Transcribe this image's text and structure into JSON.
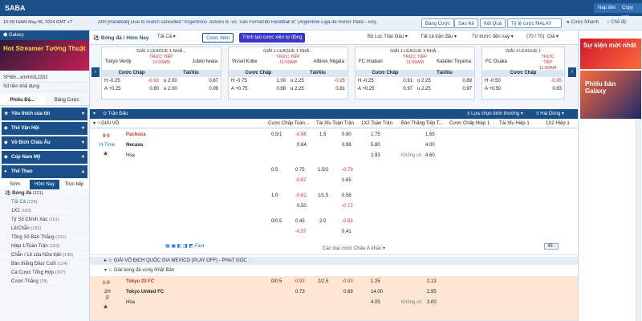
{
  "app": {
    "brand": "SABA",
    "login_label": "Nạp tiền",
    "account_label": "Copy Info"
  },
  "subbar": {
    "clock": "10:09:16AM May 06, 2024 GMT +7",
    "ticker": "Attn:[Handball] Due to match cancelled \"Argentinos Juniors B -vs- San Fernando Handball B\" [Argentine Liga de Honor Plata - 5/5],",
    "btn_bet": "Bảng Cược",
    "btn_stats": "Sao Kê",
    "btn_result": "Kết Quả",
    "odds_type": "Tỷ lệ cược MALAY",
    "radio_fast": "Cược Nhanh",
    "radio_dark": "Chế độ"
  },
  "sidebar": {
    "galaxy_label": "Galaxy",
    "banner_text": "Hot Streamer Tướng Thuật",
    "user": "SF68r...xmrhhl12332",
    "balance_label": "Số tiền khả dụng",
    "tab_live": "Phiếu Đặ...",
    "tab_bets": "Bảng Cược",
    "menu": [
      {
        "label": "Yêu thích của tôi"
      },
      {
        "label": "Thế Vận Hội"
      },
      {
        "label": "Vô Địch Châu Âu"
      },
      {
        "label": "Cúp Nam Mỹ"
      },
      {
        "label": "Thể Thao"
      }
    ],
    "sport_tabs": [
      "Sớm",
      "Hôm Nay",
      "Trực tiếp"
    ],
    "sport_head": "Bóng đá",
    "sport_head_count": "(321)",
    "sub_items": [
      {
        "label": "Tất Cả",
        "count": "(228)"
      },
      {
        "label": "1X2",
        "count": "(183)"
      },
      {
        "label": "Tỷ Số Chính Xác",
        "count": "(161)"
      },
      {
        "label": "Lẻ/Chẵn",
        "count": "(183)"
      },
      {
        "label": "Tổng Số Bàn Thắng",
        "count": "(161)"
      },
      {
        "label": "Hiệp 1/Toàn Trận",
        "count": "(183)"
      },
      {
        "label": "Chẵn / Lẻ của Nửa trận",
        "count": "(149)"
      },
      {
        "label": "Bàn thắng Đầu/ Cuối",
        "count": "(124)"
      },
      {
        "label": "Cá Cược Tổng Hợp",
        "count": "(307)"
      },
      {
        "label": "Cược Thắng",
        "count": "(28)"
      }
    ]
  },
  "filters": {
    "sport_title": "Bóng đá / Hôm Nay",
    "all": "Tất Cả",
    "combo": "Cược Xiên",
    "live_combo": "Trình tạo cược xiên tự động",
    "league_filter": "Bộ Lọc Trận Đấu",
    "all_leagues": "Tất cả trận đấu",
    "sort": "Từ trước đến nay",
    "count": "(70 / 70)",
    "one_x_two": "Giả"
  },
  "featured": [
    {
      "league": "GIẢI J-LEAGUE 1 NHẬ...",
      "home": "Tokyo Verdy",
      "away": "Jubilo Iwata",
      "status": "TRỰC TIẾP",
      "time": "11:00AM",
      "ah": [
        [
          "H -0.25",
          "-0.92"
        ],
        [
          "A +0.25",
          "0.80"
        ]
      ],
      "ou": [
        [
          "u 2.00",
          "0.87"
        ],
        [
          "u 2.00",
          "0.99"
        ]
      ]
    },
    {
      "league": "GIẢI J-LEAGUE 1 NHẬ...",
      "home": "Vissel Kobe",
      "away": "Albirex Niigata",
      "status": "TRỰC TIẾP",
      "time": "11:00AM",
      "ah": [
        [
          "H -0.75",
          "1.00"
        ],
        [
          "A +0.75",
          "0.88"
        ]
      ],
      "ou": [
        [
          "u 2.25",
          "-0.95"
        ],
        [
          "u 2.25",
          "0.81"
        ]
      ]
    },
    {
      "league": "GIẢI J-LEAGUE 3 NHẬ...",
      "home": "FC Imabari",
      "away": "Kataller Toyama",
      "status": "TRỰC TIẾP",
      "time": "11:00AM",
      "ah": [
        [
          "H -0.25",
          "0.91"
        ],
        [
          "A +0.25",
          "0.97"
        ]
      ],
      "ou": [
        [
          "u 2.25",
          "0.89"
        ],
        [
          "u 2.25",
          "0.97"
        ]
      ]
    },
    {
      "league": "GIẢI J-LEAGUE 1",
      "home": "FC Osaka",
      "away": "",
      "status": "TRỰC TIẾP",
      "time": "11:00AM",
      "ah": [
        [
          "H -0.50",
          "-0.95"
        ],
        [
          "A +0.50",
          "0.83"
        ]
      ],
      "ou": [
        [
          "",
          ""
        ],
        [
          "",
          ""
        ]
      ]
    }
  ],
  "section": {
    "title": "Trận Đấu",
    "pick_label": "Lựa chọn bình thường",
    "line_label": "Hai Dòng"
  },
  "columns": [
    "Cược Chấp Toàn ...",
    "Tài Xỉu Toàn Trận",
    "1X2 Toàn Trận",
    "Bàn Thắng Tiếp T...",
    "Cược Chấp Hiệp 1",
    "Tài Xỉu Hiệp 1",
    "1X2 Hiệp 1"
  ],
  "leagues": [
    {
      "name": "GIẢI VÔ ĐỊCH QUỐC GIA MEXICO (PLAY OFF)"
    },
    {
      "name": "GIẢI VÔ ĐỊCH QUỐC GIA MEXICO (PLAY OFF) - PHẠT GÓC"
    },
    {
      "name": "Giải bóng đá vùng Nhật Bản"
    }
  ],
  "match1": {
    "score": "0-0",
    "state": "H.Time",
    "home": "Pachuca",
    "away": "Necaxa",
    "draw": "Hòa",
    "lines": [
      {
        "hdp": "0.5/1",
        "hdp_h": "-0.96",
        "hdp_a": "0.84",
        "ou": "1.5",
        "ou_h": "0.90",
        "ou_a": "0.96",
        "x12": [
          "1.75",
          "5.80",
          "2.93"
        ],
        "next": [
          "1.55",
          "4.00",
          "4.60"
        ],
        "next_label": "Không có"
      },
      {
        "hdp": "0.5",
        "hdp_h": "0.75",
        "hdp_a": "-0.87",
        "ou": "1.5/2",
        "ou_h": "-0.79",
        "ou_a": "0.65"
      },
      {
        "hdp": "1.0",
        "hdp_h": "-0.62",
        "hdp_a": "0.50",
        "ou": "1/1.5",
        "ou_h": "0.58",
        "ou_a": "-0.72"
      },
      {
        "hdp": "0/0.5",
        "hdp_h": "0.45",
        "hdp_a": "-0.57",
        "ou": "2.0",
        "ou_h": "-0.55",
        "ou_a": "0.41"
      }
    ],
    "more_label": "Các loại cược Châu Á khác",
    "fast_label": "Fast",
    "page": "48"
  },
  "match2": {
    "score": "1-0",
    "state": "2H",
    "minute": "5'",
    "home": "Tokyo 23 FC",
    "away": "Tokyo United FC",
    "draw": "Hòa",
    "hdp": "0/0.5",
    "hdp_h": "-0.93",
    "hdp_a": "0.73",
    "ou": "2/2.5",
    "ou_h": "-0.93",
    "ou_a": "0.69",
    "x12": [
      "1.25",
      "14.00",
      "4.05"
    ],
    "next": [
      "2.13",
      "2.95",
      "3.00"
    ],
    "next_label": "Không có"
  },
  "right": {
    "promo1": "Sự kiện mới nhất",
    "promo2": "Phiếu bản Galaxy"
  }
}
